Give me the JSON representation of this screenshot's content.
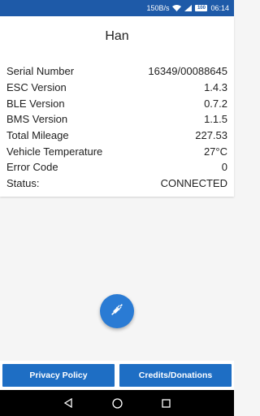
{
  "status_bar": {
    "speed": "150B/s",
    "battery": "100",
    "time": "06:14"
  },
  "device": {
    "name": "Han"
  },
  "info": [
    {
      "label": "Serial Number",
      "value": "16349/00088645"
    },
    {
      "label": "ESC Version",
      "value": "1.4.3"
    },
    {
      "label": "BLE Version",
      "value": "0.7.2"
    },
    {
      "label": "BMS Version",
      "value": "1.1.5"
    },
    {
      "label": "Total Mileage",
      "value": "227.53"
    },
    {
      "label": "Vehicle Temperature",
      "value": "27°C"
    },
    {
      "label": "Error Code",
      "value": "0"
    },
    {
      "label": "Status:",
      "value": "CONNECTED"
    }
  ],
  "fab": {
    "icon": "plug-icon"
  },
  "buttons": {
    "privacy": "Privacy Policy",
    "credits": "Credits/Donations"
  },
  "colors": {
    "status_bar": "#1e5aa8",
    "button": "#1e6ec4",
    "fab": "#2a7bd4"
  }
}
